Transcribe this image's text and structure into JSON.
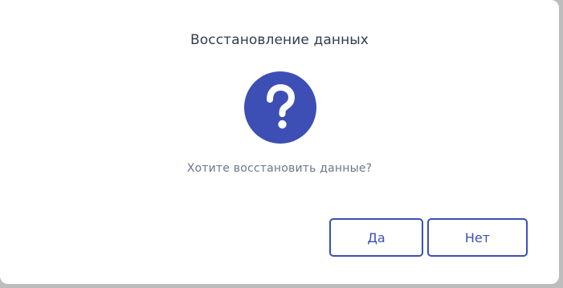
{
  "dialog": {
    "title": "Восстановление данных",
    "icon": "question-circle-icon",
    "message": "Хотите восстановить данные?",
    "buttons": {
      "yes_label": "Да",
      "no_label": "Нет"
    }
  },
  "colors": {
    "accent": "#3d4fb5",
    "title_text": "#333c4e",
    "message_text": "#6e7687",
    "background": "#ffffff"
  }
}
